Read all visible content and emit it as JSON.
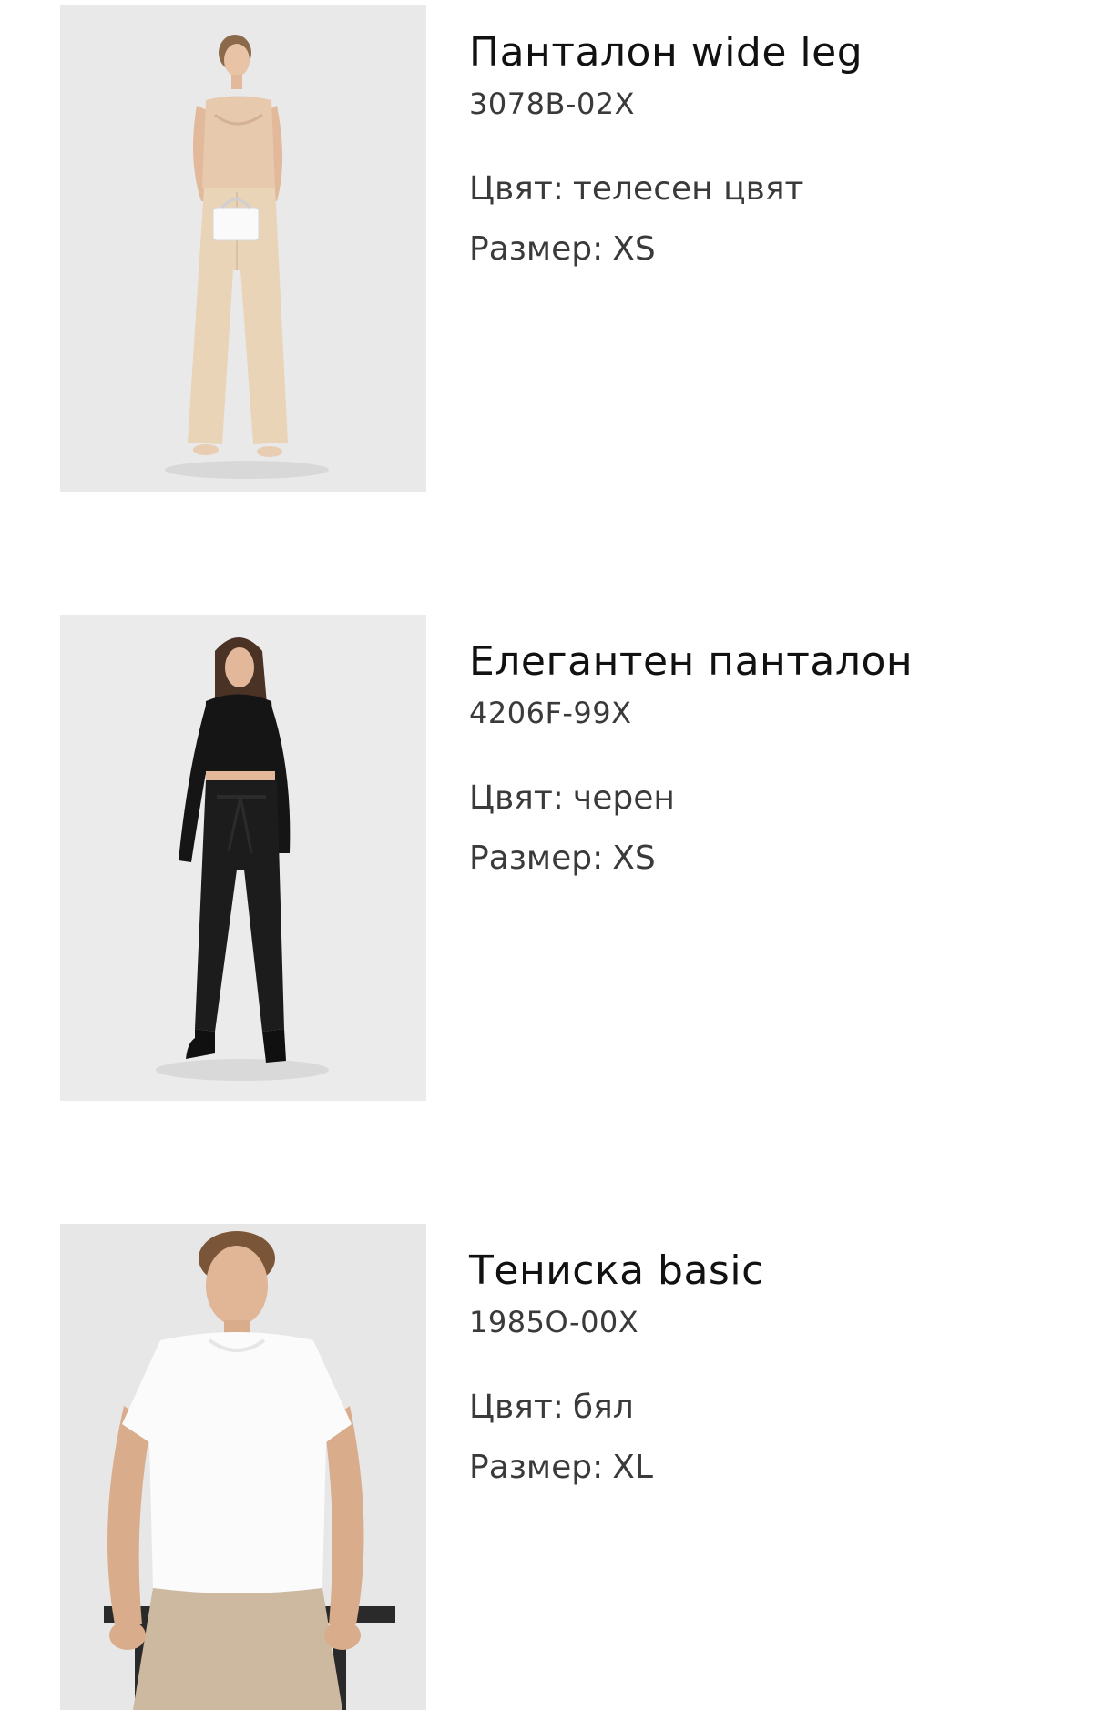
{
  "items": [
    {
      "title": "Панталон wide leg",
      "sku": "3078B-02X",
      "color_label": "Цвят:",
      "color_value": "телесен цвят",
      "size_label": "Размер:",
      "size_value": "XS",
      "photo_icon": "woman-beige-wide-leg-pants-photo"
    },
    {
      "title": "Елегантен панталон",
      "sku": "4206F-99X",
      "color_label": "Цвят:",
      "color_value": "черен",
      "size_label": "Размер:",
      "size_value": "XS",
      "photo_icon": "woman-black-outfit-photo"
    },
    {
      "title": "Тениска basic",
      "sku": "1985O-00X",
      "color_label": "Цвят:",
      "color_value": "бял",
      "size_label": "Размер:",
      "size_value": "XL",
      "photo_icon": "man-white-tshirt-photo"
    }
  ],
  "colors": {
    "background": "#ffffff",
    "title": "#111111",
    "secondary_text": "#3a3a3a",
    "photo_background": "#e8e8e8"
  }
}
